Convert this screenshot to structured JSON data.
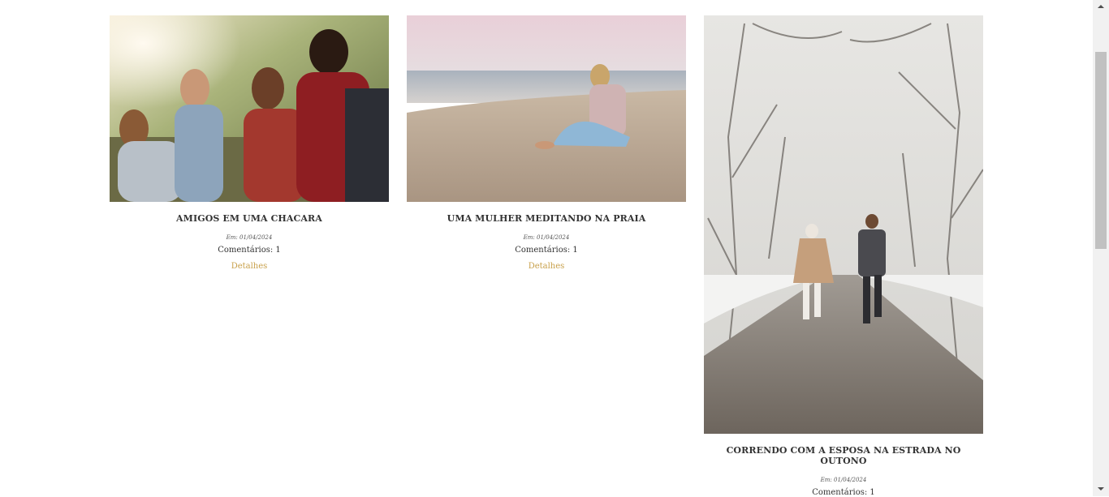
{
  "posts": [
    {
      "title": "AMIGOS EM UMA CHACARA",
      "date": "Em: 01/04/2024",
      "comments": "Comentários: 1",
      "details": "Detalhes"
    },
    {
      "title": "UMA MULHER MEDITANDO NA PRAIA",
      "date": "Em: 01/04/2024",
      "comments": "Comentários: 1",
      "details": "Detalhes"
    },
    {
      "title": "CORRENDO COM A ESPOSA NA ESTRADA NO OUTONO",
      "date": "Em: 01/04/2024",
      "comments": "Comentários: 1"
    }
  ],
  "colors": {
    "accent": "#c8a04a",
    "text": "#333333"
  }
}
